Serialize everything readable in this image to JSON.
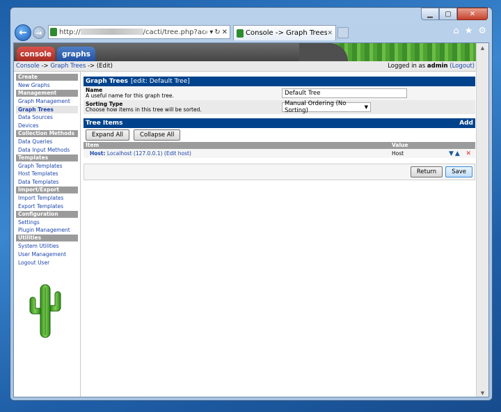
{
  "browser": {
    "address": {
      "prefix": "http://",
      "suffix": "/cacti/tree.php?actior"
    },
    "tab_title": "Console -> Graph Trees ...",
    "close_glyph": "✕"
  },
  "cacti": {
    "tabs": {
      "console": "console",
      "graphs": "graphs"
    },
    "breadcrumb": {
      "console": "Console",
      "sep1": " -> ",
      "graph_trees": "Graph Trees",
      "sep2": " -> ",
      "current": "(Edit)"
    },
    "login": {
      "prefix": "Logged in as ",
      "user": "admin",
      "logout": "(Logout)"
    }
  },
  "sidebar": {
    "sections": [
      {
        "header": "Create",
        "items": [
          "New Graphs"
        ]
      },
      {
        "header": "Management",
        "items": [
          "Graph Management",
          "Graph Trees",
          "Data Sources",
          "Devices"
        ]
      },
      {
        "header": "Collection Methods",
        "items": [
          "Data Queries",
          "Data Input Methods"
        ]
      },
      {
        "header": "Templates",
        "items": [
          "Graph Templates",
          "Host Templates",
          "Data Templates"
        ]
      },
      {
        "header": "Import/Export",
        "items": [
          "Import Templates",
          "Export Templates"
        ]
      },
      {
        "header": "Configuration",
        "items": [
          "Settings",
          "Plugin Management"
        ]
      },
      {
        "header": "Utilities",
        "items": [
          "System Utilities",
          "User Management",
          "Logout User"
        ]
      }
    ],
    "active": "Graph Trees"
  },
  "graph_trees": {
    "title": "Graph Trees",
    "subtitle": "[edit: Default Tree]",
    "name_label": "Name",
    "name_desc": "A useful name for this graph tree.",
    "name_value": "Default Tree",
    "sort_label": "Sorting Type",
    "sort_desc": "Choose how items in this tree will be sorted.",
    "sort_value": "Manual Ordering (No Sorting)"
  },
  "tree_items": {
    "title": "Tree Items",
    "add": "Add",
    "expand": "Expand All",
    "collapse": "Collapse All",
    "columns": {
      "item": "Item",
      "value": "Value"
    },
    "rows": [
      {
        "host_label": "Host:",
        "host": "Localhost (127.0.0.1)",
        "edit": "(Edit host)",
        "value": "Host"
      }
    ]
  },
  "actions": {
    "return": "Return",
    "save": "Save"
  }
}
